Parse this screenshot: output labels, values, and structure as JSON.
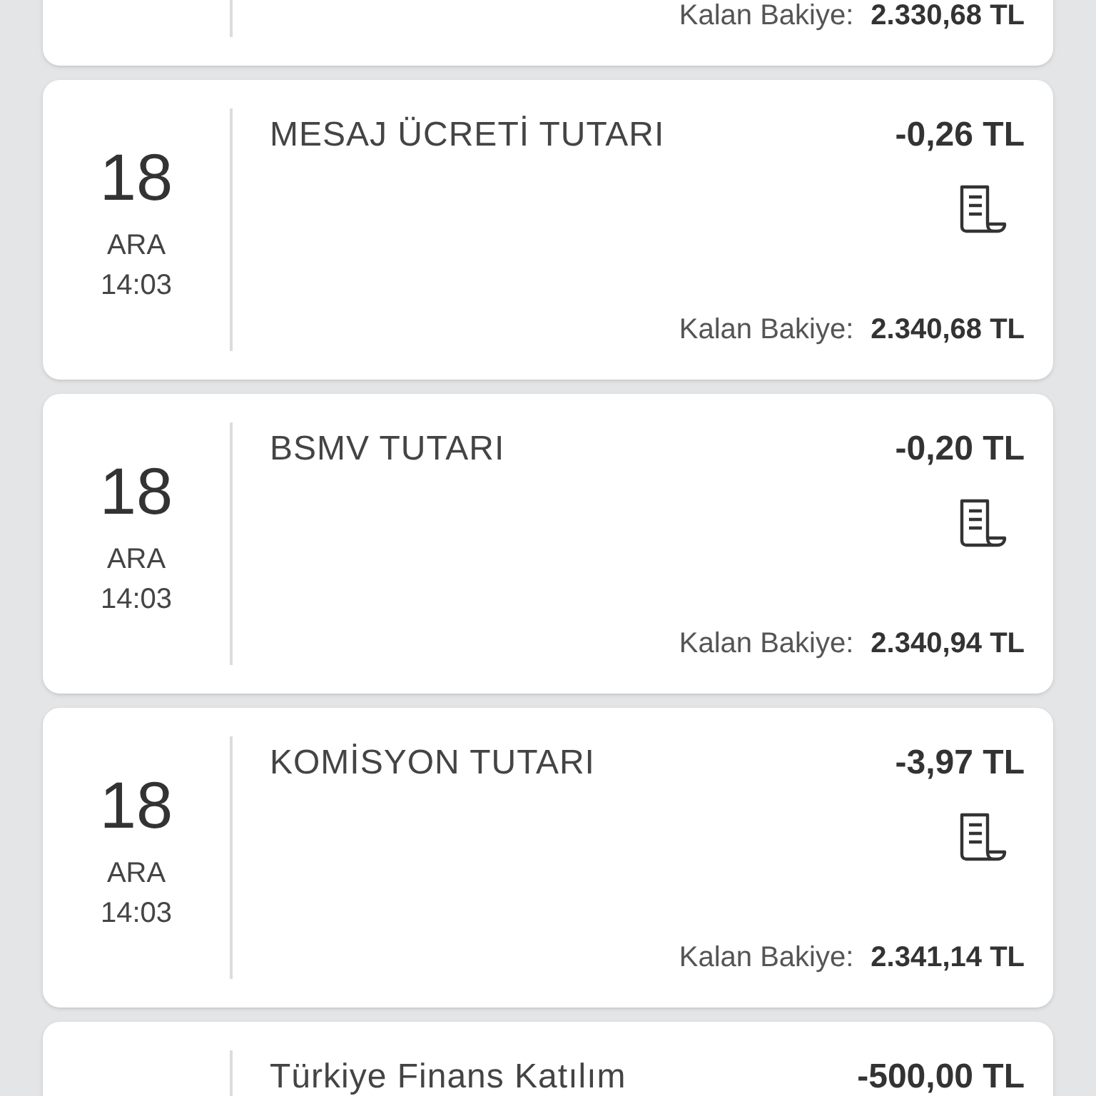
{
  "transactions": [
    {
      "balance_label": "Kalan Bakiye:",
      "balance": "2.330,68 TL"
    },
    {
      "day": "18",
      "month": "ARA",
      "time": "14:03",
      "title": "MESAJ ÜCRETİ TUTARI",
      "amount": "-0,26 TL",
      "receipt": true,
      "balance_label": "Kalan Bakiye:",
      "balance": "2.340,68 TL"
    },
    {
      "day": "18",
      "month": "ARA",
      "time": "14:03",
      "title": "BSMV TUTARI",
      "amount": "-0,20 TL",
      "receipt": true,
      "balance_label": "Kalan Bakiye:",
      "balance": "2.340,94 TL"
    },
    {
      "day": "18",
      "month": "ARA",
      "time": "14:03",
      "title": "KOMİSYON TUTARI",
      "amount": "-3,97 TL",
      "receipt": true,
      "balance_label": "Kalan Bakiye:",
      "balance": "2.341,14 TL"
    },
    {
      "title": "Türkiye Finans Katılım",
      "amount": "-500,00 TL"
    }
  ]
}
